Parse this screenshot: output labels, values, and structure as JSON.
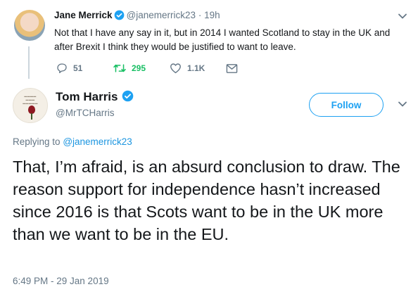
{
  "parent_tweet": {
    "name": "Jane Merrick",
    "handle": "@janemerrick23",
    "separator": "·",
    "time": "19h",
    "text": "Not that I have any say in it, but in 2014 I wanted Scotland to stay in the UK and after Brexit I think they would be justified to want to leave.",
    "replies": "51",
    "retweets": "295",
    "likes": "1.1K"
  },
  "main_tweet": {
    "name": "Tom Harris",
    "handle": "@MrTCHarris",
    "follow_label": "Follow",
    "replying_prefix": "Replying to",
    "replying_handle": "@janemerrick23",
    "text": "That, I’m afraid, is an absurd conclusion to draw. The reason support for independence hasn’t increased since 2016 is that Scots want to be in the UK more than we want to be in the EU.",
    "timestamp": "6:49 PM - 29 Jan 2019"
  },
  "colors": {
    "verified": "#1da1f2",
    "retweet_active": "#17bf63",
    "link": "#1b95e0",
    "muted": "#657786"
  },
  "icons": [
    "verified-icon",
    "chevron-down-icon",
    "reply-icon",
    "retweet-icon",
    "like-icon",
    "direct-message-icon"
  ]
}
